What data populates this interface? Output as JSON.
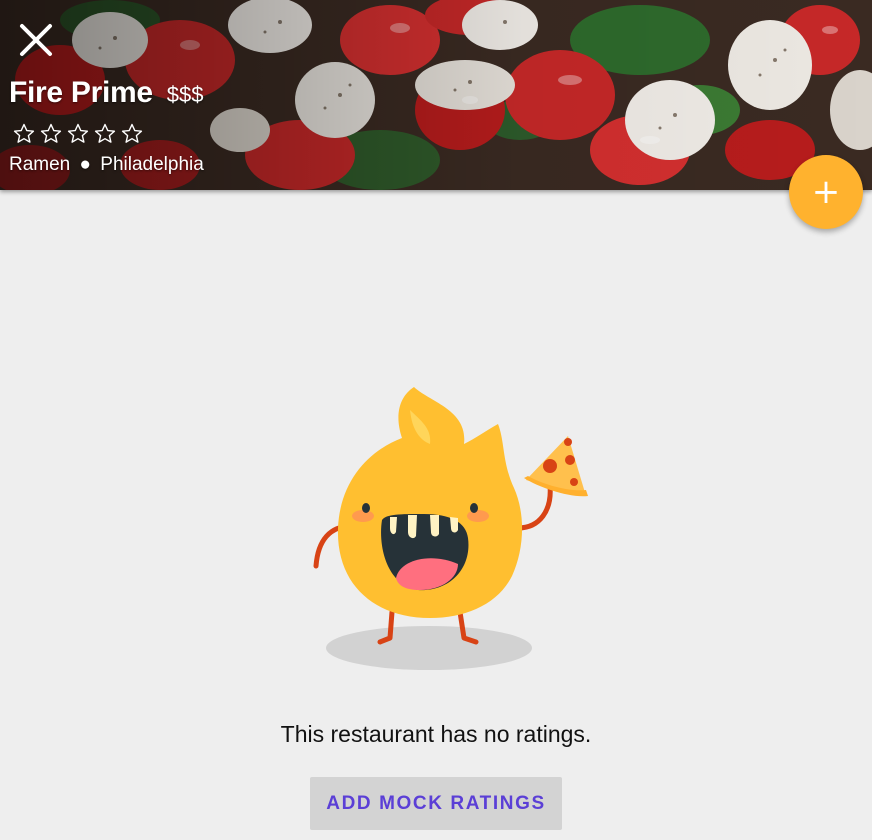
{
  "header": {
    "restaurant_name": "Fire Prime",
    "price": "$$$",
    "rating_stars": 0,
    "max_stars": 5,
    "category": "Ramen",
    "separator": "●",
    "city": "Philadelphia",
    "photo": "caprese-salad-photo"
  },
  "icons": {
    "close": "close-icon",
    "add": "plus-icon",
    "star": "star-outline-icon"
  },
  "fab": {
    "label": "+",
    "color": "#ffb22e"
  },
  "empty_state": {
    "message": "This restaurant has no ratings.",
    "button_label": "ADD MOCK RATINGS",
    "illustration": "fire-mascot-with-pizza"
  },
  "colors": {
    "accent": "#ffb22e",
    "button_text": "#5b3fd6",
    "background": "#eeeeee"
  }
}
